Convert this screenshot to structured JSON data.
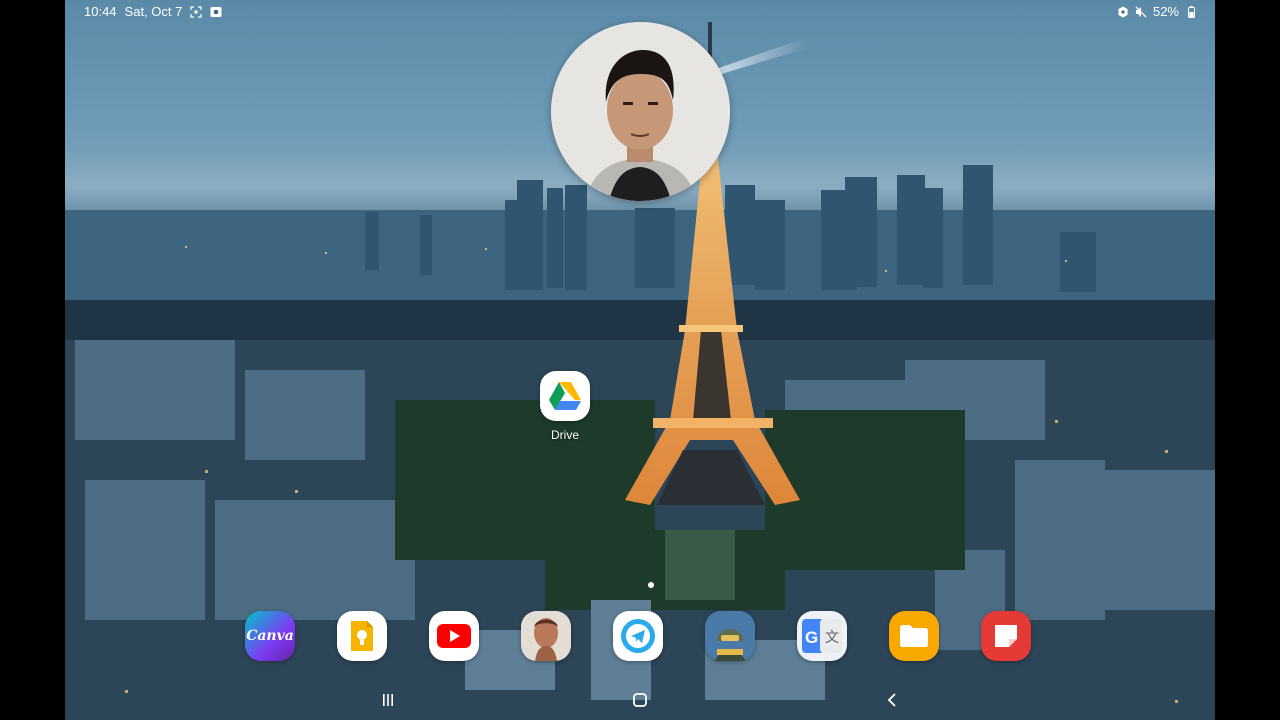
{
  "status_bar": {
    "time": "10:44",
    "date": "Sat, Oct 7",
    "battery": "52%",
    "left_icons": [
      "screenshot-icon",
      "camera-indicator-icon"
    ],
    "right_icons": [
      "data-saver-icon",
      "mute-icon",
      "battery-icon"
    ]
  },
  "home_screen": {
    "wallpaper": "eiffel-tower-paris-dusk",
    "apps": [
      {
        "label": "Drive",
        "icon": "google-drive-icon"
      }
    ],
    "page_indicator": {
      "pages": 1,
      "current": 1
    }
  },
  "camera_overlay": {
    "icon": "front-camera-bubble"
  },
  "dock": [
    {
      "icon": "canva-icon",
      "text": "Canva",
      "color": "#7d3cf2"
    },
    {
      "icon": "google-keep-icon",
      "color": "#f6b400"
    },
    {
      "icon": "youtube-icon",
      "color": "#ff0000"
    },
    {
      "icon": "face-app-icon",
      "color": "#c58a6b"
    },
    {
      "icon": "telegram-icon",
      "color": "#2aabee"
    },
    {
      "icon": "pubg-mobile-icon",
      "color": "#3d6f9c"
    },
    {
      "icon": "google-translate-icon",
      "color": "#4285f4"
    },
    {
      "icon": "my-files-icon",
      "color": "#f8a800"
    },
    {
      "icon": "samsung-notes-icon",
      "color": "#e53935"
    }
  ],
  "nav_bar": [
    "recents-icon",
    "home-icon",
    "back-icon"
  ]
}
